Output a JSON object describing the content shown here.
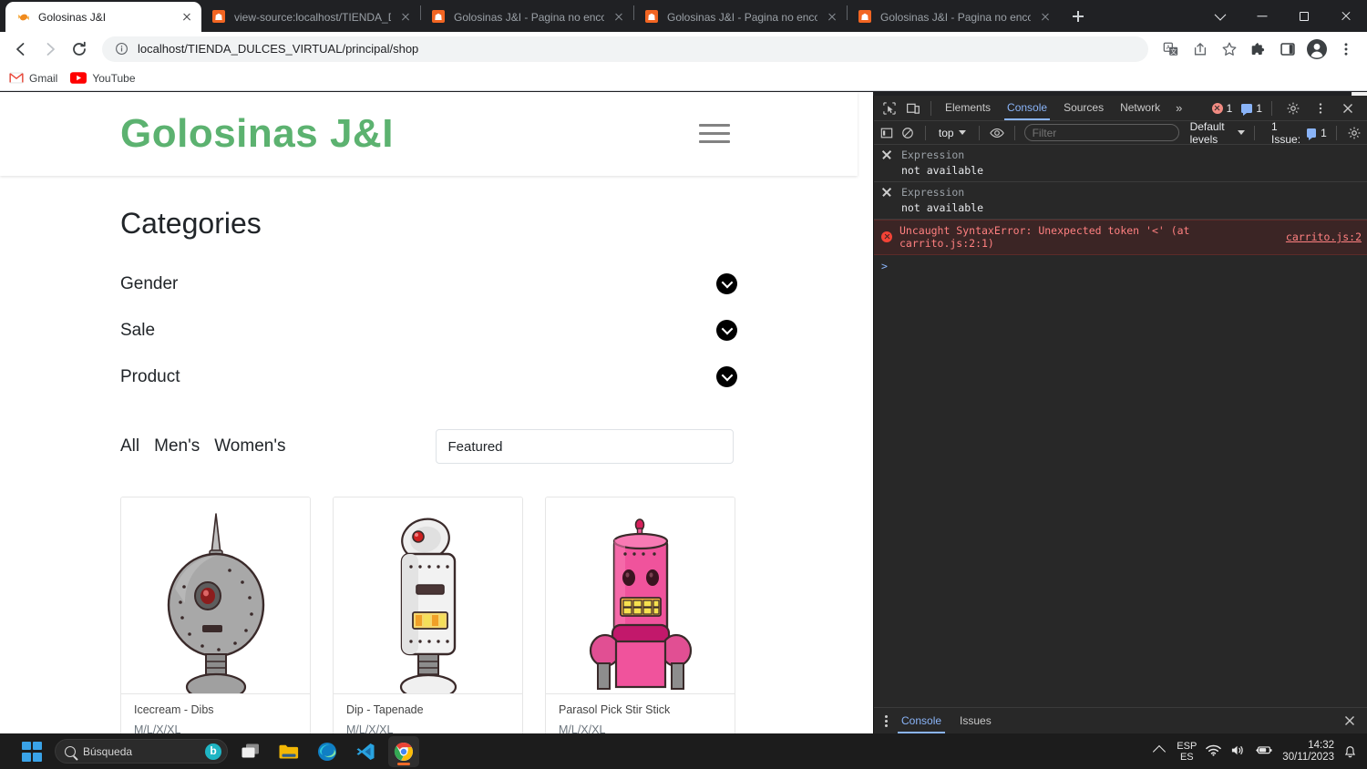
{
  "browser": {
    "tabs": [
      {
        "title": "Golosinas J&I",
        "favicon": "candy-icon",
        "active": true
      },
      {
        "title": "view-source:localhost/TIENDA_D",
        "favicon": "orange-app-icon",
        "active": false
      },
      {
        "title": "Golosinas J&I - Pagina no encon",
        "favicon": "orange-app-icon",
        "active": false
      },
      {
        "title": "Golosinas J&I - Pagina no encon",
        "favicon": "orange-app-icon",
        "active": false
      },
      {
        "title": "Golosinas J&I - Pagina no encon",
        "favicon": "orange-app-icon",
        "active": false
      }
    ],
    "new_tab_label": "+",
    "address": {
      "url": "localhost/TIENDA_DULCES_VIRTUAL/principal/shop",
      "host": "localhost",
      "path": "/TIENDA_DULCES_VIRTUAL/principal/shop",
      "security_icon": "info-circle-icon"
    },
    "nav": {
      "back": "back-icon",
      "forward": "forward-icon",
      "reload": "reload-icon"
    },
    "toolbar_right": [
      "translate-icon",
      "share-icon",
      "bookmark-star-icon",
      "extensions-puzzle-icon",
      "side-panel-icon",
      "profile-avatar-icon",
      "chrome-menu-icon"
    ],
    "window_controls": [
      "chevron-down-icon",
      "minimize-icon",
      "maximize-icon",
      "close-icon"
    ],
    "bookmarks": [
      {
        "label": "Gmail",
        "icon": "gmail-icon"
      },
      {
        "label": "YouTube",
        "icon": "youtube-icon"
      }
    ]
  },
  "page": {
    "brand": "Golosinas J&I",
    "brand_color": "#5cb270",
    "menu_icon": "hamburger-menu-icon",
    "categories_title": "Categories",
    "filters": [
      {
        "label": "Gender",
        "icon": "chevron-down-circle-icon"
      },
      {
        "label": "Sale",
        "icon": "chevron-down-circle-icon"
      },
      {
        "label": "Product",
        "icon": "chevron-down-circle-icon"
      }
    ],
    "tabs": [
      "All",
      "Men's",
      "Women's"
    ],
    "sort": {
      "value": "Featured",
      "placeholder": "Featured"
    },
    "products": [
      {
        "name": "Icecream - Dibs",
        "sizes": "M/L/X/XL",
        "image": "grey-robot-image"
      },
      {
        "name": "Dip - Tapenade",
        "sizes": "M/L/X/XL",
        "image": "white-robot-image"
      },
      {
        "name": "Parasol Pick Stir Stick",
        "sizes": "M/L/X/XL",
        "image": "pink-robot-image"
      }
    ]
  },
  "devtools": {
    "panel_tabs": [
      "Elements",
      "Console",
      "Sources",
      "Network"
    ],
    "active_panel": "Console",
    "more_panels": "»",
    "inspect_icon": "inspect-element-icon",
    "device_icon": "device-toolbar-icon",
    "error_count": "1",
    "message_count": "1",
    "settings_icon": "gear-icon",
    "kebab_icon": "more-options-icon",
    "close_icon": "close-icon",
    "console_toolbar": {
      "sidebar_icon": "console-sidebar-icon",
      "clear_icon": "clear-console-icon",
      "context": "top",
      "eye_icon": "live-expression-eye-icon",
      "filter_placeholder": "Filter",
      "filter_value": "",
      "levels": "Default levels",
      "issues_label": "1 Issue:",
      "issues_count": "1",
      "settings_icon": "gear-icon"
    },
    "messages": [
      {
        "type": "live-expression",
        "title": "Expression",
        "body": "not available"
      },
      {
        "type": "live-expression",
        "title": "Expression",
        "body": "not available"
      },
      {
        "type": "error",
        "text": "Uncaught SyntaxError: Unexpected token '<' (at carrito.js:2:1)",
        "link_inline": "carrito.js:2:1",
        "source_link": "carrito.js:2"
      }
    ],
    "prompt": ">",
    "drawer_tabs": [
      "Console",
      "Issues"
    ],
    "drawer_active": "Console"
  },
  "taskbar": {
    "start_icon": "windows-start-icon",
    "search_placeholder": "Búsqueda",
    "search_assistant_icon": "bing-chat-icon",
    "apps": [
      {
        "name": "task-view-icon"
      },
      {
        "name": "file-explorer-icon"
      },
      {
        "name": "edge-icon"
      },
      {
        "name": "vscode-icon"
      },
      {
        "name": "chrome-icon"
      }
    ],
    "tray": {
      "overflow_icon": "show-hidden-icons-chevron",
      "language_line1": "ESP",
      "language_line2": "ES",
      "wifi_icon": "wifi-icon",
      "volume_icon": "volume-icon",
      "battery_icon": "battery-icon",
      "time": "14:32",
      "date": "30/11/2023",
      "notification_icon": "notification-bell-icon"
    }
  }
}
